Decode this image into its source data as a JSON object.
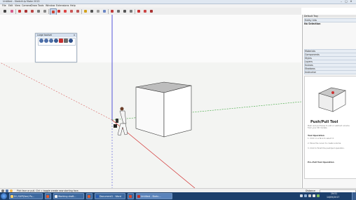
{
  "app": {
    "title": "Untitled - SketchUp Make 2015",
    "controls": [
      "–",
      "□",
      "✕"
    ]
  },
  "menubar": {
    "items": [
      "File",
      "Edit",
      "View",
      "Camera",
      "Draw",
      "Tools",
      "Window",
      "Extensions",
      "Help"
    ]
  },
  "toolbar": {
    "tools": [
      "select",
      "eraser",
      "line",
      "freehand",
      "arc",
      "rectangle",
      "shapes",
      "push-pull",
      "move",
      "rotate",
      "scale",
      "offset",
      "tape-measure",
      "text",
      "axes",
      "paint-bucket",
      "orbit",
      "pan",
      "zoom",
      "zoom-extents",
      "previous",
      "warehouse",
      "extension-warehouse",
      "layout"
    ]
  },
  "floating_toolbar": {
    "title": "Large toolset",
    "close": "x",
    "icons": [
      "camera-icon",
      "orbit-icon",
      "pan-icon",
      "zoom-icon",
      "red-icon",
      "walk-icon",
      "globe-icon"
    ]
  },
  "tray": {
    "title": "Default Tray",
    "entity_info": {
      "label": "Entity Info",
      "value": "No Selection"
    },
    "sections": [
      "Materials",
      "Components",
      "Styles",
      "Layers",
      "Scenes",
      "Shadows",
      "Instructor"
    ],
    "instructor": {
      "tool_title": "Push/Pull Tool",
      "description": "Push and pull faces to add or subtract volume from your 3D models.",
      "operation_heading": "Tool Operation",
      "steps": [
        "1. Click on a face to select it.",
        "2. Move the cursor to create volume.",
        "3. Click to finish the push/pull operation."
      ],
      "footer": "Pre-Pull Tool Operation"
    }
  },
  "status": {
    "message": "Pick face or pull. Ctrl = toggle create new starting face.",
    "measurement_label": "Distance",
    "measurement_value": ""
  },
  "taskbar": {
    "apps": [
      {
        "label": "D:\\ SUP\\Dev\\ Pu...",
        "color": "#ffd16a"
      },
      {
        "label": "Working draft...",
        "color": "#f1f1f1"
      },
      {
        "label": "",
        "color": "#e25b2d"
      },
      {
        "label": "Document1 - Word",
        "color": "#2b5eb4"
      },
      {
        "label": "",
        "color": "#e04a2a"
      },
      {
        "label": "Untitled - Sketc...",
        "color": "#c73228"
      }
    ],
    "time": "19:51",
    "date": "14/05/2017"
  },
  "colors": {
    "red_axis": "#d12c2c",
    "green_axis": "#3aa53a",
    "blue_axis": "#2a2ad1"
  }
}
